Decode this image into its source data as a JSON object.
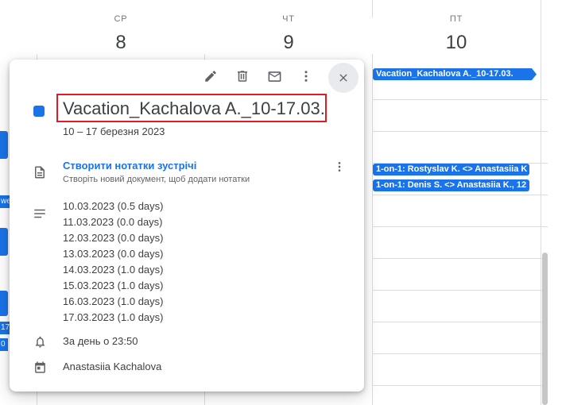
{
  "calendar": {
    "days": [
      {
        "name": "СР",
        "num": "8"
      },
      {
        "name": "ЧТ",
        "num": "9"
      },
      {
        "name": "ПТ",
        "num": "10"
      }
    ],
    "events": [
      {
        "label": "Vacation_Kachalova A._10-17.03."
      },
      {
        "label": "1-on-1: Rostyslav K. <> Anastasiia K"
      },
      {
        "label": "1-on-1: Denis S. <> Anastasiia K., 12"
      }
    ],
    "left_fragments": [
      "we",
      "17",
      "0"
    ],
    "accent_color": "#1a73e8"
  },
  "popup": {
    "toolbar_icons": [
      "edit-icon",
      "delete-icon",
      "email-icon",
      "more-vert-icon",
      "close-icon"
    ],
    "title": "Vacation_Kachalova A._10-17.03.",
    "date_range": "10 – 17 березня 2023",
    "notes": {
      "link": "Створити нотатки зустрічі",
      "subtitle": "Створіть новий документ, щоб додати нотатки"
    },
    "description": [
      "10.03.2023 (0.5 days)",
      "11.03.2023 (0.0 days)",
      "12.03.2023 (0.0 days)",
      "13.03.2023 (0.0 days)",
      "14.03.2023 (1.0 days)",
      "15.03.2023 (1.0 days)",
      "16.03.2023 (1.0 days)",
      "17.03.2023 (1.0 days)"
    ],
    "reminder": "За день о 23:50",
    "calendar_owner": "Anastasiia Kachalova",
    "highlight_color": "#e01b24"
  }
}
